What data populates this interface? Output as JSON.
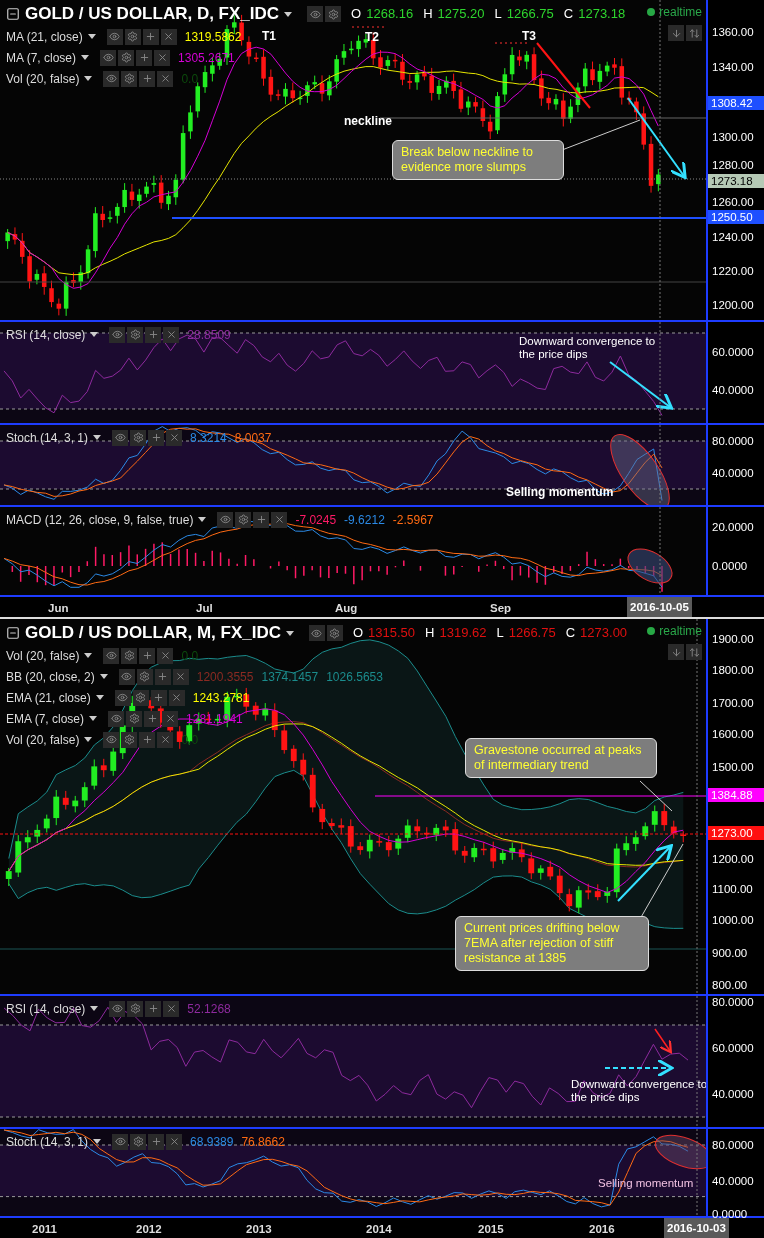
{
  "charts": [
    {
      "title": "GOLD / US DOLLAR, D, FX_IDC",
      "realtime": "realtime",
      "ohlc": [
        {
          "letter": "O",
          "value": "1268.16",
          "color": "#2ed52e"
        },
        {
          "letter": "H",
          "value": "1275.20",
          "color": "#2ed52e"
        },
        {
          "letter": "L",
          "value": "1266.75",
          "color": "#2ed52e"
        },
        {
          "letter": "C",
          "value": "1273.18",
          "color": "#2ed52e"
        }
      ],
      "panes": [
        {
          "kind": "price",
          "legends": [
            {
              "label": "MA (21, close)",
              "values": [
                {
                  "text": "1319.5862",
                  "color": "#ffff00"
                }
              ]
            },
            {
              "label": "MA (7, close)",
              "values": [
                {
                  "text": "1305.2671",
                  "color": "#d500d5"
                }
              ]
            },
            {
              "label": "Vol (20, false)",
              "values": [
                {
                  "text": "0.0",
                  "color": "#0c4a0c"
                }
              ]
            }
          ],
          "axis_labels": [
            "1360.00",
            "1340.00",
            "1300.00",
            "1280.00",
            "1260.00",
            "1240.00",
            "1220.00",
            "1200.00"
          ],
          "price_tags": [
            {
              "text": "1308.42",
              "color": "#1e4fff"
            },
            {
              "text": "1273.18",
              "color": "#b5c9b5"
            },
            {
              "text": "1250.50",
              "color": "#1e4fff"
            }
          ],
          "annotations": [
            {
              "kind": "label",
              "text": "T1"
            },
            {
              "kind": "label",
              "text": "T2"
            },
            {
              "kind": "label",
              "text": "T3"
            },
            {
              "kind": "label",
              "text": "neckline"
            },
            {
              "kind": "callout",
              "text": "Break below neckline to evidence more slumps"
            }
          ]
        },
        {
          "kind": "rsi",
          "legends": [
            {
              "label": "RSI (14, close)",
              "values": [
                {
                  "text": "28.8509",
                  "color": "#8e2a9e"
                }
              ]
            }
          ],
          "axis_labels": [
            "60.0000",
            "40.0000"
          ],
          "annotations": [
            {
              "kind": "note",
              "text": "Downward convergence to the price dips"
            }
          ]
        },
        {
          "kind": "stoch",
          "legends": [
            {
              "label": "Stoch (14, 3, 1)",
              "values": [
                {
                  "text": "8.3214",
                  "color": "#2b8ae6"
                },
                {
                  "text": "8.0037",
                  "color": "#ff6a13"
                }
              ]
            }
          ],
          "axis_labels": [
            "80.0000",
            "40.0000"
          ],
          "annotations": [
            {
              "kind": "bold",
              "text": "Selling momentum"
            }
          ]
        },
        {
          "kind": "macd",
          "legends": [
            {
              "label": "MACD (12, 26, close, 9, false, true)",
              "values": [
                {
                  "text": "-7.0245",
                  "color": "#ff1a66"
                },
                {
                  "text": "-9.6212",
                  "color": "#2b8ae6"
                },
                {
                  "text": "-2.5967",
                  "color": "#ff6a13"
                }
              ]
            }
          ],
          "axis_labels": [
            "20.0000",
            "0.0000"
          ]
        }
      ],
      "time_axis": {
        "labels": [
          "Jun",
          "Jul",
          "Aug",
          "Sep"
        ],
        "cursor": "2016-10-05"
      }
    },
    {
      "title": "GOLD / US DOLLAR, M, FX_IDC",
      "realtime": "realtime",
      "ohlc": [
        {
          "letter": "O",
          "value": "1315.50",
          "color": "#e01010"
        },
        {
          "letter": "H",
          "value": "1319.62",
          "color": "#e01010"
        },
        {
          "letter": "L",
          "value": "1266.75",
          "color": "#e01010"
        },
        {
          "letter": "C",
          "value": "1273.00",
          "color": "#e01010"
        }
      ],
      "panes": [
        {
          "kind": "price",
          "legends": [
            {
              "label": "Vol (20, false)",
              "values": [
                {
                  "text": "0.0",
                  "color": "#0c4a0c"
                }
              ]
            },
            {
              "label": "BB (20, close, 2)",
              "values": [
                {
                  "text": "1200.3555",
                  "color": "#8b2a22"
                },
                {
                  "text": "1374.1457",
                  "color": "#1b8c8c"
                },
                {
                  "text": "1026.5653",
                  "color": "#1b8c8d"
                }
              ]
            },
            {
              "label": "EMA (21, close)",
              "values": [
                {
                  "text": "1243.2781",
                  "color": "#ffff00"
                }
              ]
            },
            {
              "label": "EMA (7, close)",
              "values": [
                {
                  "text": "1281.1941",
                  "color": "#d500d5"
                }
              ]
            },
            {
              "label": "Vol (20, false)",
              "values": [
                {
                  "text": "0.0",
                  "color": "#0c4a0d"
                }
              ]
            }
          ],
          "axis_labels": [
            "1900.00",
            "1800.00",
            "1700.00",
            "1600.00",
            "1500.00",
            "1200.00",
            "1100.00",
            "1000.00",
            "900.00",
            "800.00"
          ],
          "price_tags": [
            {
              "text": "1384.88",
              "color": "#ff00ff"
            },
            {
              "text": "1273.00",
              "color": "#ff1010"
            }
          ],
          "annotations": [
            {
              "kind": "callout",
              "text": "Gravestone occurred at peaks of intermediary trend"
            },
            {
              "kind": "callout",
              "text": "Current prices drifting below 7EMA after rejection of stiff resistance at 1385"
            }
          ]
        },
        {
          "kind": "rsi",
          "legends": [
            {
              "label": "RSI (14, close)",
              "values": [
                {
                  "text": "52.1268",
                  "color": "#8e2a9e"
                }
              ]
            }
          ],
          "axis_labels": [
            "80.0000",
            "60.0000",
            "40.0000"
          ],
          "annotations": [
            {
              "kind": "note",
              "text": "Downward convergence to the price dips"
            }
          ]
        },
        {
          "kind": "stoch",
          "legends": [
            {
              "label": "Stoch (14, 3, 1)",
              "values": [
                {
                  "text": "68.9389",
                  "color": "#2b8ae6"
                },
                {
                  "text": "76.8662",
                  "color": "#ff6a13"
                }
              ]
            }
          ],
          "axis_labels": [
            "80.0000",
            "40.0000",
            "0.0000"
          ],
          "annotations": [
            {
              "kind": "pink",
              "text": "Selling momentum"
            }
          ]
        }
      ],
      "time_axis": {
        "labels": [
          "2011",
          "2012",
          "2013",
          "2014",
          "2015",
          "2016"
        ],
        "cursor": "2016-10-03"
      }
    }
  ]
}
